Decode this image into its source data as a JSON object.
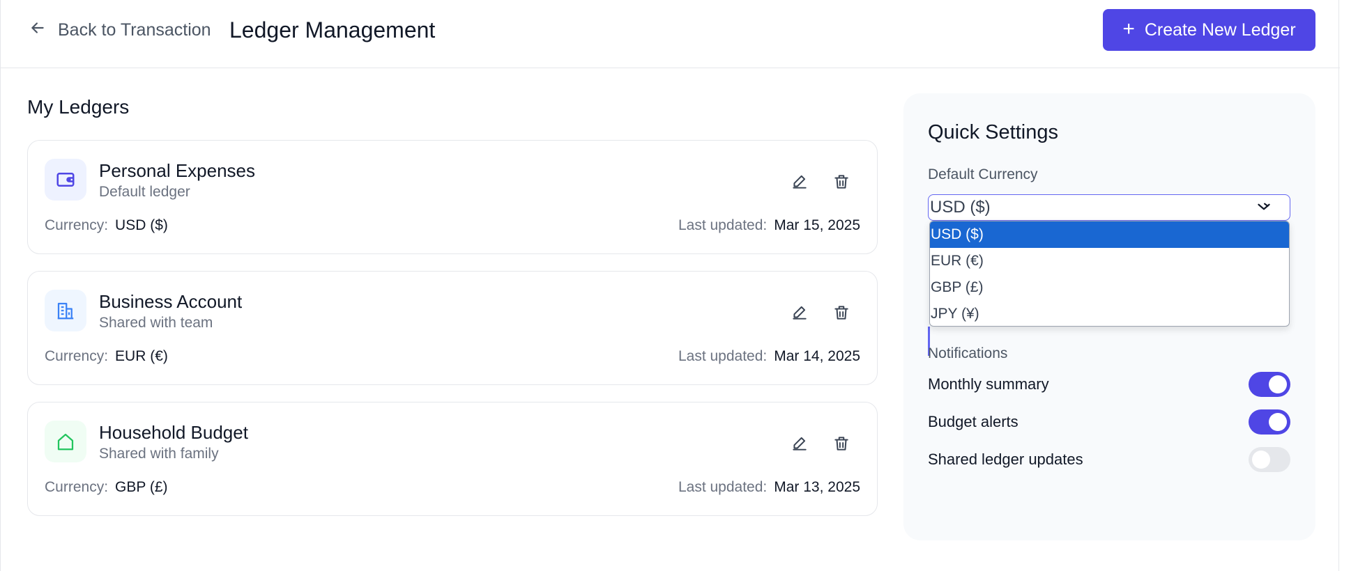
{
  "header": {
    "back_label": "Back to Transaction",
    "title": "Ledger Management",
    "create_label": "Create New Ledger"
  },
  "ledgers_section": {
    "title": "My Ledgers",
    "currency_label": "Currency:",
    "updated_label": "Last updated:",
    "items": [
      {
        "name": "Personal Expenses",
        "subtitle": "Default ledger",
        "currency": "USD ($)",
        "updated": "Mar 15, 2025",
        "icon": "wallet-icon",
        "icon_color": "#4f46e5",
        "icon_bg": "#eef2ff"
      },
      {
        "name": "Business Account",
        "subtitle": "Shared with team",
        "currency": "EUR (€)",
        "updated": "Mar 14, 2025",
        "icon": "building-icon",
        "icon_color": "#3b82f6",
        "icon_bg": "#eff6ff"
      },
      {
        "name": "Household Budget",
        "subtitle": "Shared with family",
        "currency": "GBP (£)",
        "updated": "Mar 13, 2025",
        "icon": "home-icon",
        "icon_color": "#22c55e",
        "icon_bg": "#f0fdf4"
      }
    ]
  },
  "quick_settings": {
    "title": "Quick Settings",
    "currency_label": "Default Currency",
    "currency_value": "USD ($)",
    "currency_options": [
      "USD ($)",
      "EUR (€)",
      "GBP (£)",
      "JPY (¥)"
    ],
    "selected_index": 0,
    "notifications_label": "Notifications",
    "notifications": [
      {
        "label": "Monthly summary",
        "enabled": true
      },
      {
        "label": "Budget alerts",
        "enabled": true
      },
      {
        "label": "Shared ledger updates",
        "enabled": false
      }
    ]
  },
  "colors": {
    "accent": "#4f46e5",
    "selected_option": "#1967d2"
  }
}
